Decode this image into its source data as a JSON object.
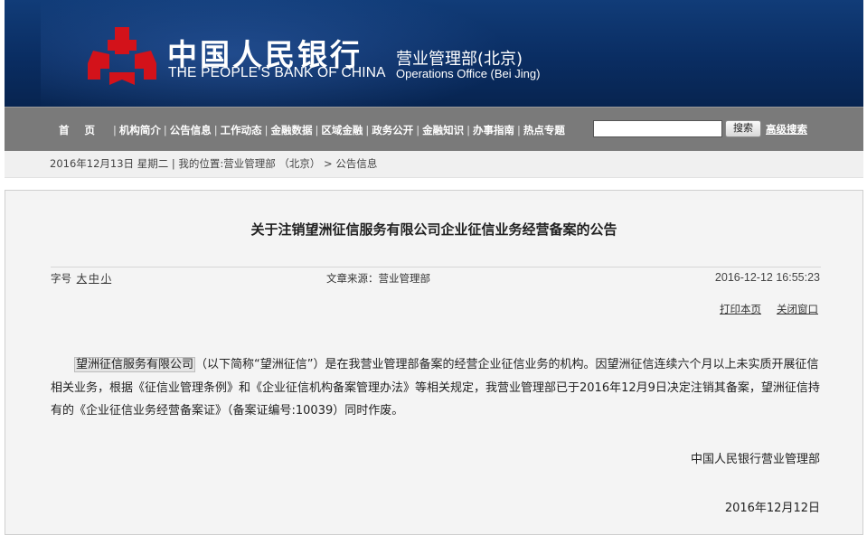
{
  "header": {
    "bank_name_cn": "中国人民银行",
    "bank_name_en": "THE PEOPLE'S BANK OF CHINA",
    "dept_cn": "营业管理部(北京)",
    "dept_en": "Operations Office (Bei Jing)",
    "logo_icon": "pboc-logo-icon",
    "brand_color": "#0a2d62",
    "logo_color": "#d3121a"
  },
  "nav": {
    "items": [
      {
        "label": "首页"
      },
      {
        "label": "机构简介"
      },
      {
        "label": "公告信息"
      },
      {
        "label": "工作动态"
      },
      {
        "label": "金融数据"
      },
      {
        "label": "区域金融"
      },
      {
        "label": "政务公开"
      },
      {
        "label": "金融知识"
      },
      {
        "label": "办事指南"
      },
      {
        "label": "热点专题"
      }
    ],
    "search_value": "",
    "search_button": "搜索",
    "advanced_search": "高级搜索"
  },
  "breadcrumb": {
    "text": "2016年12月13日 星期二 | 我的位置:营业管理部 （北京） > 公告信息"
  },
  "article": {
    "title": "关于注销望洲征信服务有限公司企业征信业务经营备案的公告",
    "font_size_label": "字号",
    "font_sizes": [
      "大",
      "中",
      "小"
    ],
    "source": "文章来源：营业管理部",
    "date": "2016-12-12 16:55:23",
    "print": "打印本页",
    "close": "关闭窗口",
    "company_highlight": "望洲征信服务有限公司",
    "body_rest": "（以下简称“望洲征信”）是在我营业管理部备案的经营企业征信业务的机构。因望洲征信连续六个月以上未实质开展征信相关业务，根据《征信业管理条例》和《企业征信机构备案管理办法》等相关规定，我营业管理部已于2016年12月9日决定注销其备案，望洲征信持有的《企业征信业务经营备案证》（备案证编号:10039）同时作废。",
    "signature_org": "中国人民银行营业管理部",
    "signature_date": "2016年12月12日"
  }
}
